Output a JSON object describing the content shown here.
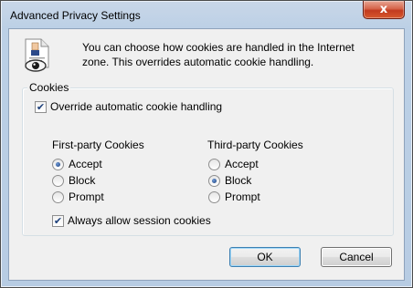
{
  "window": {
    "title": "Advanced Privacy Settings",
    "close_label": "x"
  },
  "info": {
    "icon": "privacy-eye-document-icon",
    "text": "You can choose how cookies are handled in the Internet zone.  This overrides automatic cookie handling."
  },
  "cookies": {
    "legend": "Cookies",
    "override": {
      "label": "Override automatic cookie handling",
      "checked": true
    },
    "first_party": {
      "label": "First-party Cookies",
      "options": [
        "Accept",
        "Block",
        "Prompt"
      ],
      "selected": "Accept"
    },
    "third_party": {
      "label": "Third-party Cookies",
      "options": [
        "Accept",
        "Block",
        "Prompt"
      ],
      "selected": "Block"
    },
    "session": {
      "label": "Always allow session cookies",
      "checked": true
    }
  },
  "buttons": {
    "ok": "OK",
    "cancel": "Cancel"
  }
}
